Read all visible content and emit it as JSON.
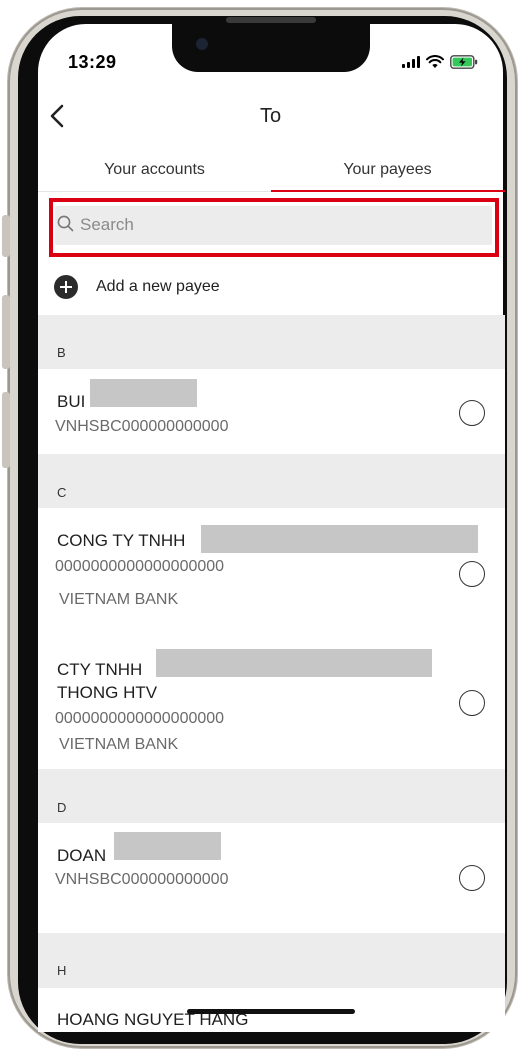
{
  "status_bar": {
    "time": "13:29"
  },
  "header": {
    "title": "To"
  },
  "tabs": [
    {
      "label": "Your accounts"
    },
    {
      "label": "Your payees"
    }
  ],
  "search": {
    "placeholder": "Search"
  },
  "add_payee": {
    "label": "Add a new payee"
  },
  "sections": [
    {
      "letter": "B"
    },
    {
      "letter": "C"
    },
    {
      "letter": "D"
    },
    {
      "letter": "H"
    }
  ],
  "payees": [
    {
      "name": "BUI",
      "account": "VNHSBC000000000000"
    },
    {
      "name": "CONG TY TNHH",
      "account": "0000000000000000000",
      "bank": "VIETNAM BANK"
    },
    {
      "name_line1": "CTY TNHH",
      "name_line2": "THONG HTV",
      "account": "0000000000000000000",
      "bank": "VIETNAM BANK"
    },
    {
      "name": "DOAN",
      "account": "VNHSBC000000000000"
    },
    {
      "name": "HOANG NGUYET HANG"
    }
  ],
  "colors": {
    "accent": "#db0011",
    "section_bg": "#ececec",
    "redaction": "#c6c6c6"
  }
}
